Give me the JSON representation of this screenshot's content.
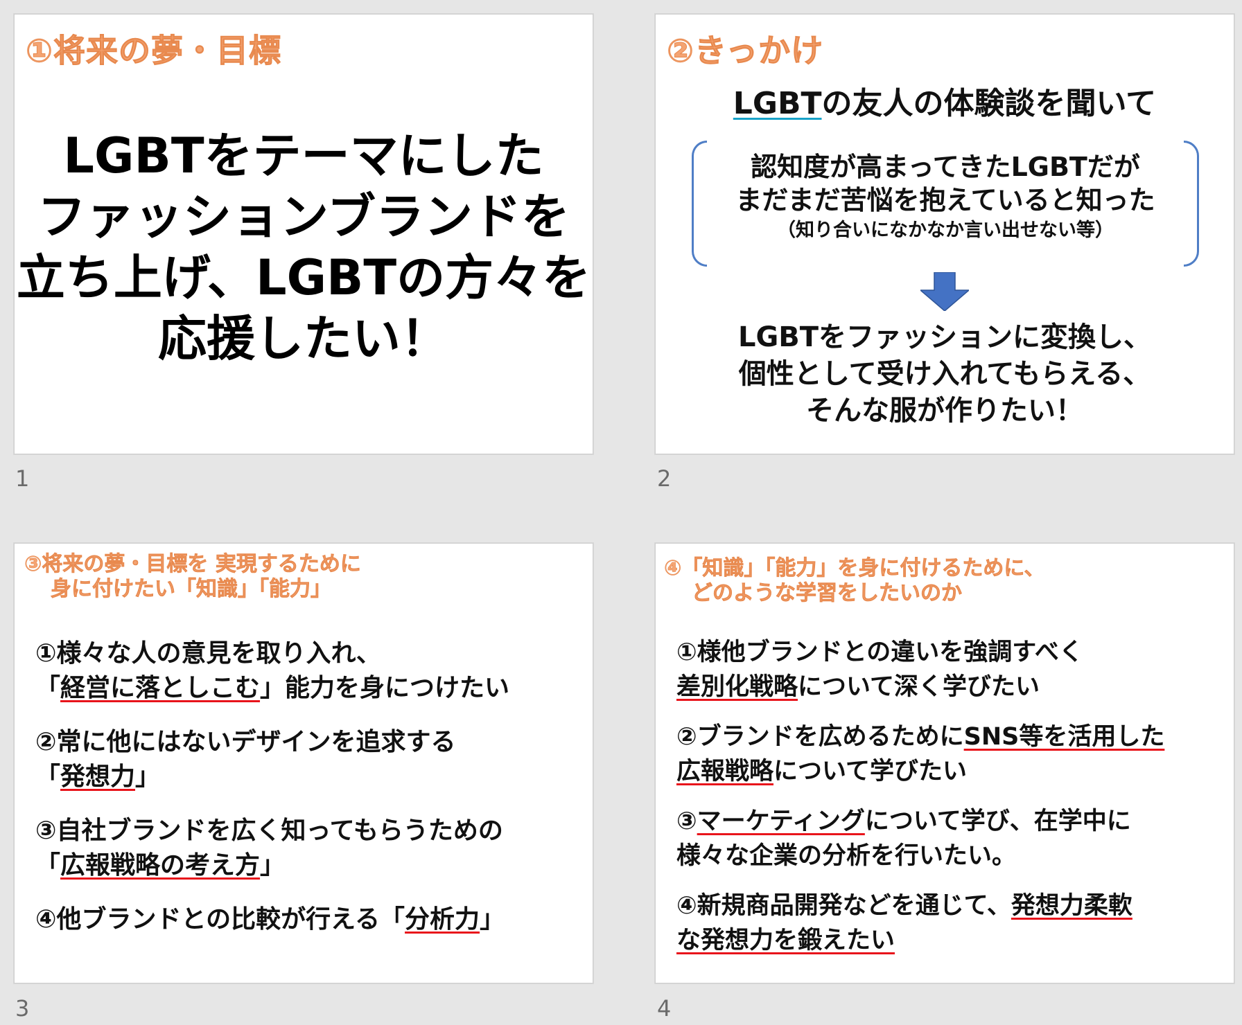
{
  "colors": {
    "title_orange": "#f4a473",
    "accent_blue": "#4f7ec6",
    "underline_red": "#e8141b",
    "underline_cyan": "#19a3c9",
    "background": "#e6e6e6"
  },
  "slides": [
    {
      "number": "1",
      "title": "①将来の夢・目標",
      "body_lines": [
        "LGBTをテーマにした",
        "ファッションブランドを",
        "立ち上げ、LGBTの方々を",
        "応援したい！"
      ]
    },
    {
      "number": "2",
      "title": "②きっかけ",
      "heading_ul": "LGBT",
      "heading_rest": "の友人の体験談を聞いて",
      "bracket_lines": [
        "認知度が高まってきたLGBTだが",
        "まだまだ苦悩を抱えていると知った",
        "（知り合いになかなか言い出せない等）"
      ],
      "arrow_icon": "down-arrow-icon",
      "result_lines": [
        "LGBTをファッションに変換し、",
        "個性として受け入れてもらえる、",
        "そんな服が作りたい！"
      ]
    },
    {
      "number": "3",
      "title_lines": [
        "③将来の夢・目標を 実現するために",
        "身に付けたい「知識」「能力」"
      ],
      "items": [
        {
          "a": "①様々な人の意見を取り入れ、",
          "b_pre": "「",
          "b_ul": "経営に落としこむ",
          "b_post": "」能力を身につけたい"
        },
        {
          "a": "②常に他にはないデザインを追求する",
          "b_pre": "「",
          "b_ul": "発想力",
          "b_post": "」"
        },
        {
          "a": "③自社ブランドを広く知ってもらうための",
          "b_pre": "「",
          "b_ul": "広報戦略の考え方",
          "b_post": "」"
        },
        {
          "a_pre": "④他ブランドとの比較が行える「",
          "a_ul": "分析力",
          "a_post": "」"
        }
      ]
    },
    {
      "number": "4",
      "title_lines": [
        "④「知識」「能力」を身に付けるために、",
        "どのような学習をしたいのか"
      ],
      "items": [
        {
          "a": "①様他ブランドとの違いを強調すべく",
          "b_ul": "差別化戦略",
          "b_post": "について深く学びたい"
        },
        {
          "a_pre": "②ブランドを広めるために",
          "a_ul": "SNS等を活用した",
          "b_ul": "広報戦略",
          "b_post": "について学びたい"
        },
        {
          "a_pre": "③",
          "a_ul": "マーケティング",
          "a_post": "について学び、在学中に",
          "b": "様々な企業の分析を行いたい。"
        },
        {
          "a_pre": "④新規商品開発などを通じて、",
          "a_ul": "発想力柔軟",
          "b_ul": "な発想力を鍛えたい"
        }
      ]
    }
  ]
}
